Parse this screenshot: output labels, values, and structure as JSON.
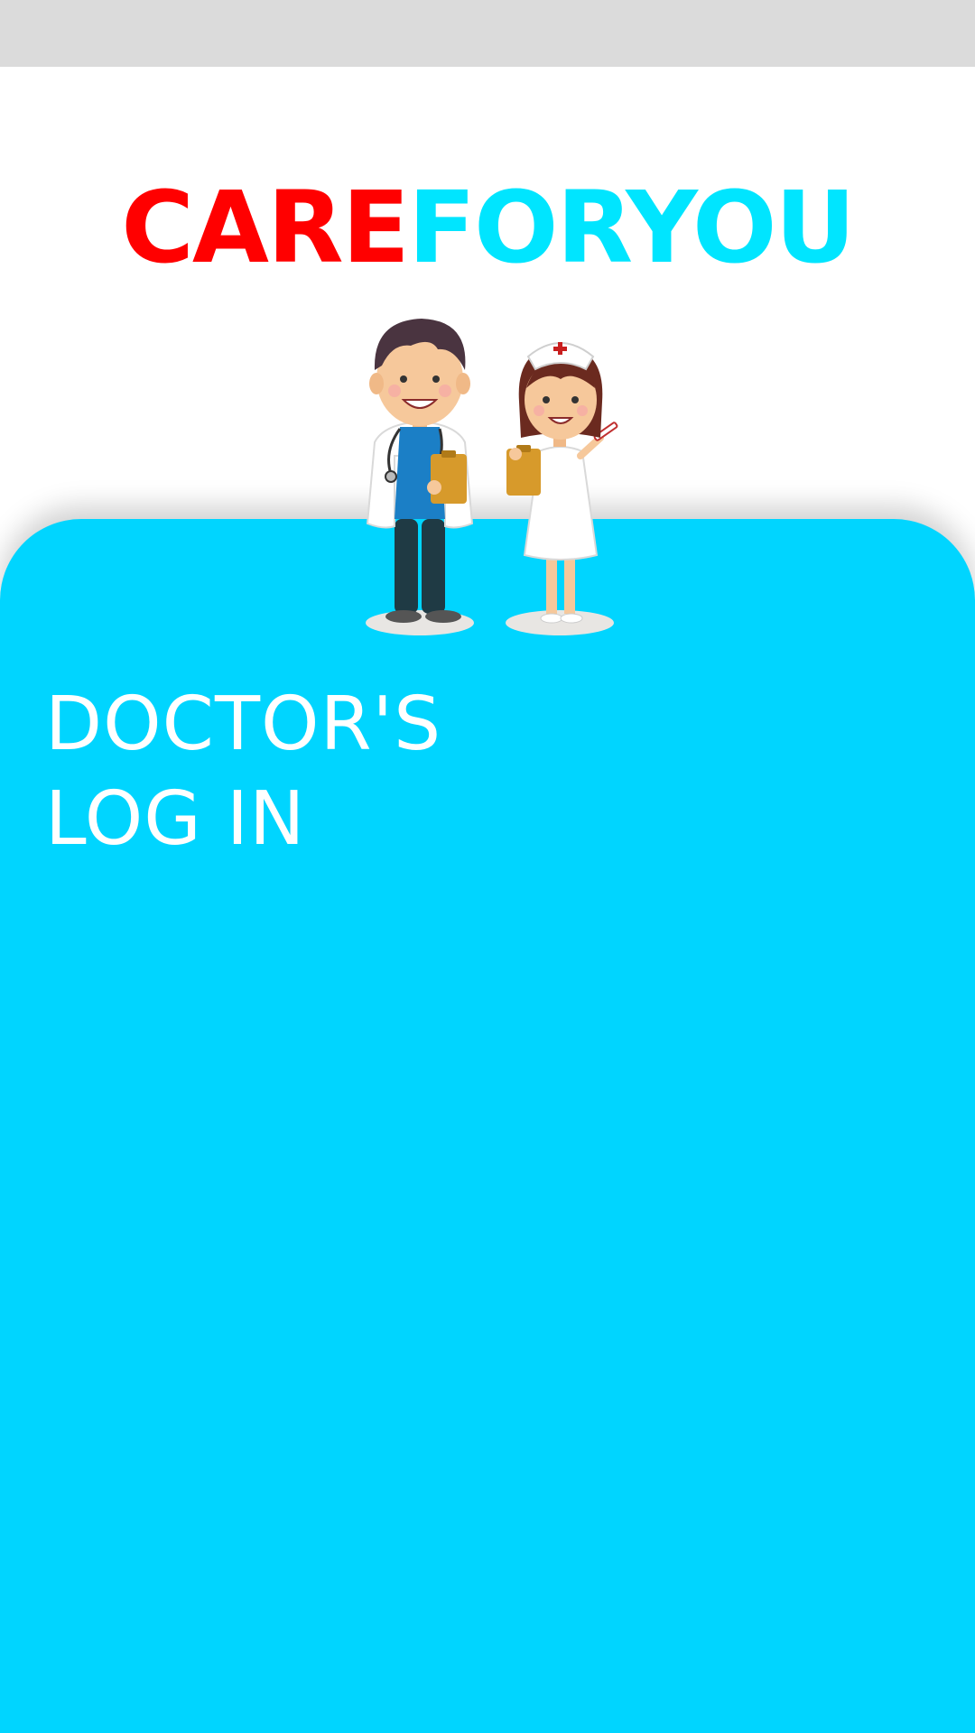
{
  "status_bar": {},
  "logo": {
    "part_a": "CARE",
    "part_b": "FORYOU",
    "color_a": "#ff0000",
    "color_b": "#00e5ff"
  },
  "illustration": {
    "icon": "doctor-and-nurse-icon"
  },
  "login_panel": {
    "title_line1": "DOCTOR'S",
    "title_line2": "LOG IN",
    "background_color": "#00d5ff"
  }
}
